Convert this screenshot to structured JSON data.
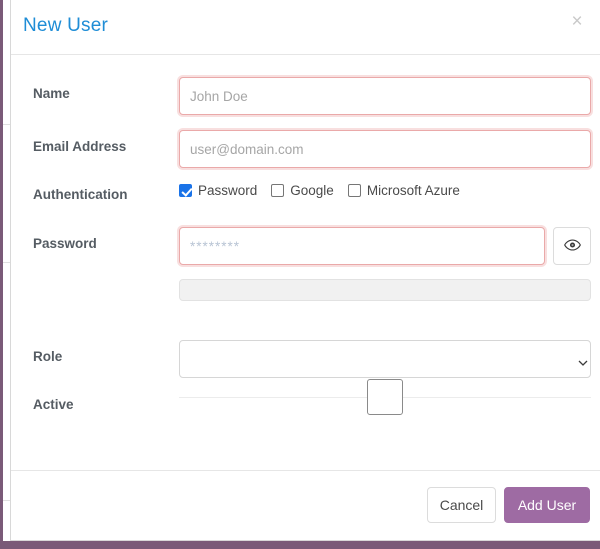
{
  "theme": {
    "title_color": "#1f8dd6",
    "primary_button_color": "#9e6ba3",
    "invalid_border_color": "#eaa9a9",
    "checkbox_checked_color": "#1a73e8",
    "backdrop_color": "#7a5a78"
  },
  "modal": {
    "title": "New User",
    "close_label": "×"
  },
  "form": {
    "name": {
      "label": "Name",
      "value": "",
      "placeholder": "John Doe"
    },
    "email": {
      "label": "Email Address",
      "value": "",
      "placeholder": "user@domain.com"
    },
    "authentication": {
      "label": "Authentication",
      "options": [
        {
          "label": "Password",
          "checked": true
        },
        {
          "label": "Google",
          "checked": false
        },
        {
          "label": "Microsoft Azure",
          "checked": false
        }
      ]
    },
    "password": {
      "label": "Password",
      "value": "",
      "placeholder": "********",
      "toggle_icon": "eye-icon",
      "strength_value": 0
    },
    "role": {
      "label": "Role",
      "selected": "",
      "options": [
        ""
      ],
      "chevron_icon": "chevron-down-icon"
    },
    "active": {
      "label": "Active",
      "checked": false
    }
  },
  "footer": {
    "cancel_label": "Cancel",
    "submit_label": "Add User"
  }
}
